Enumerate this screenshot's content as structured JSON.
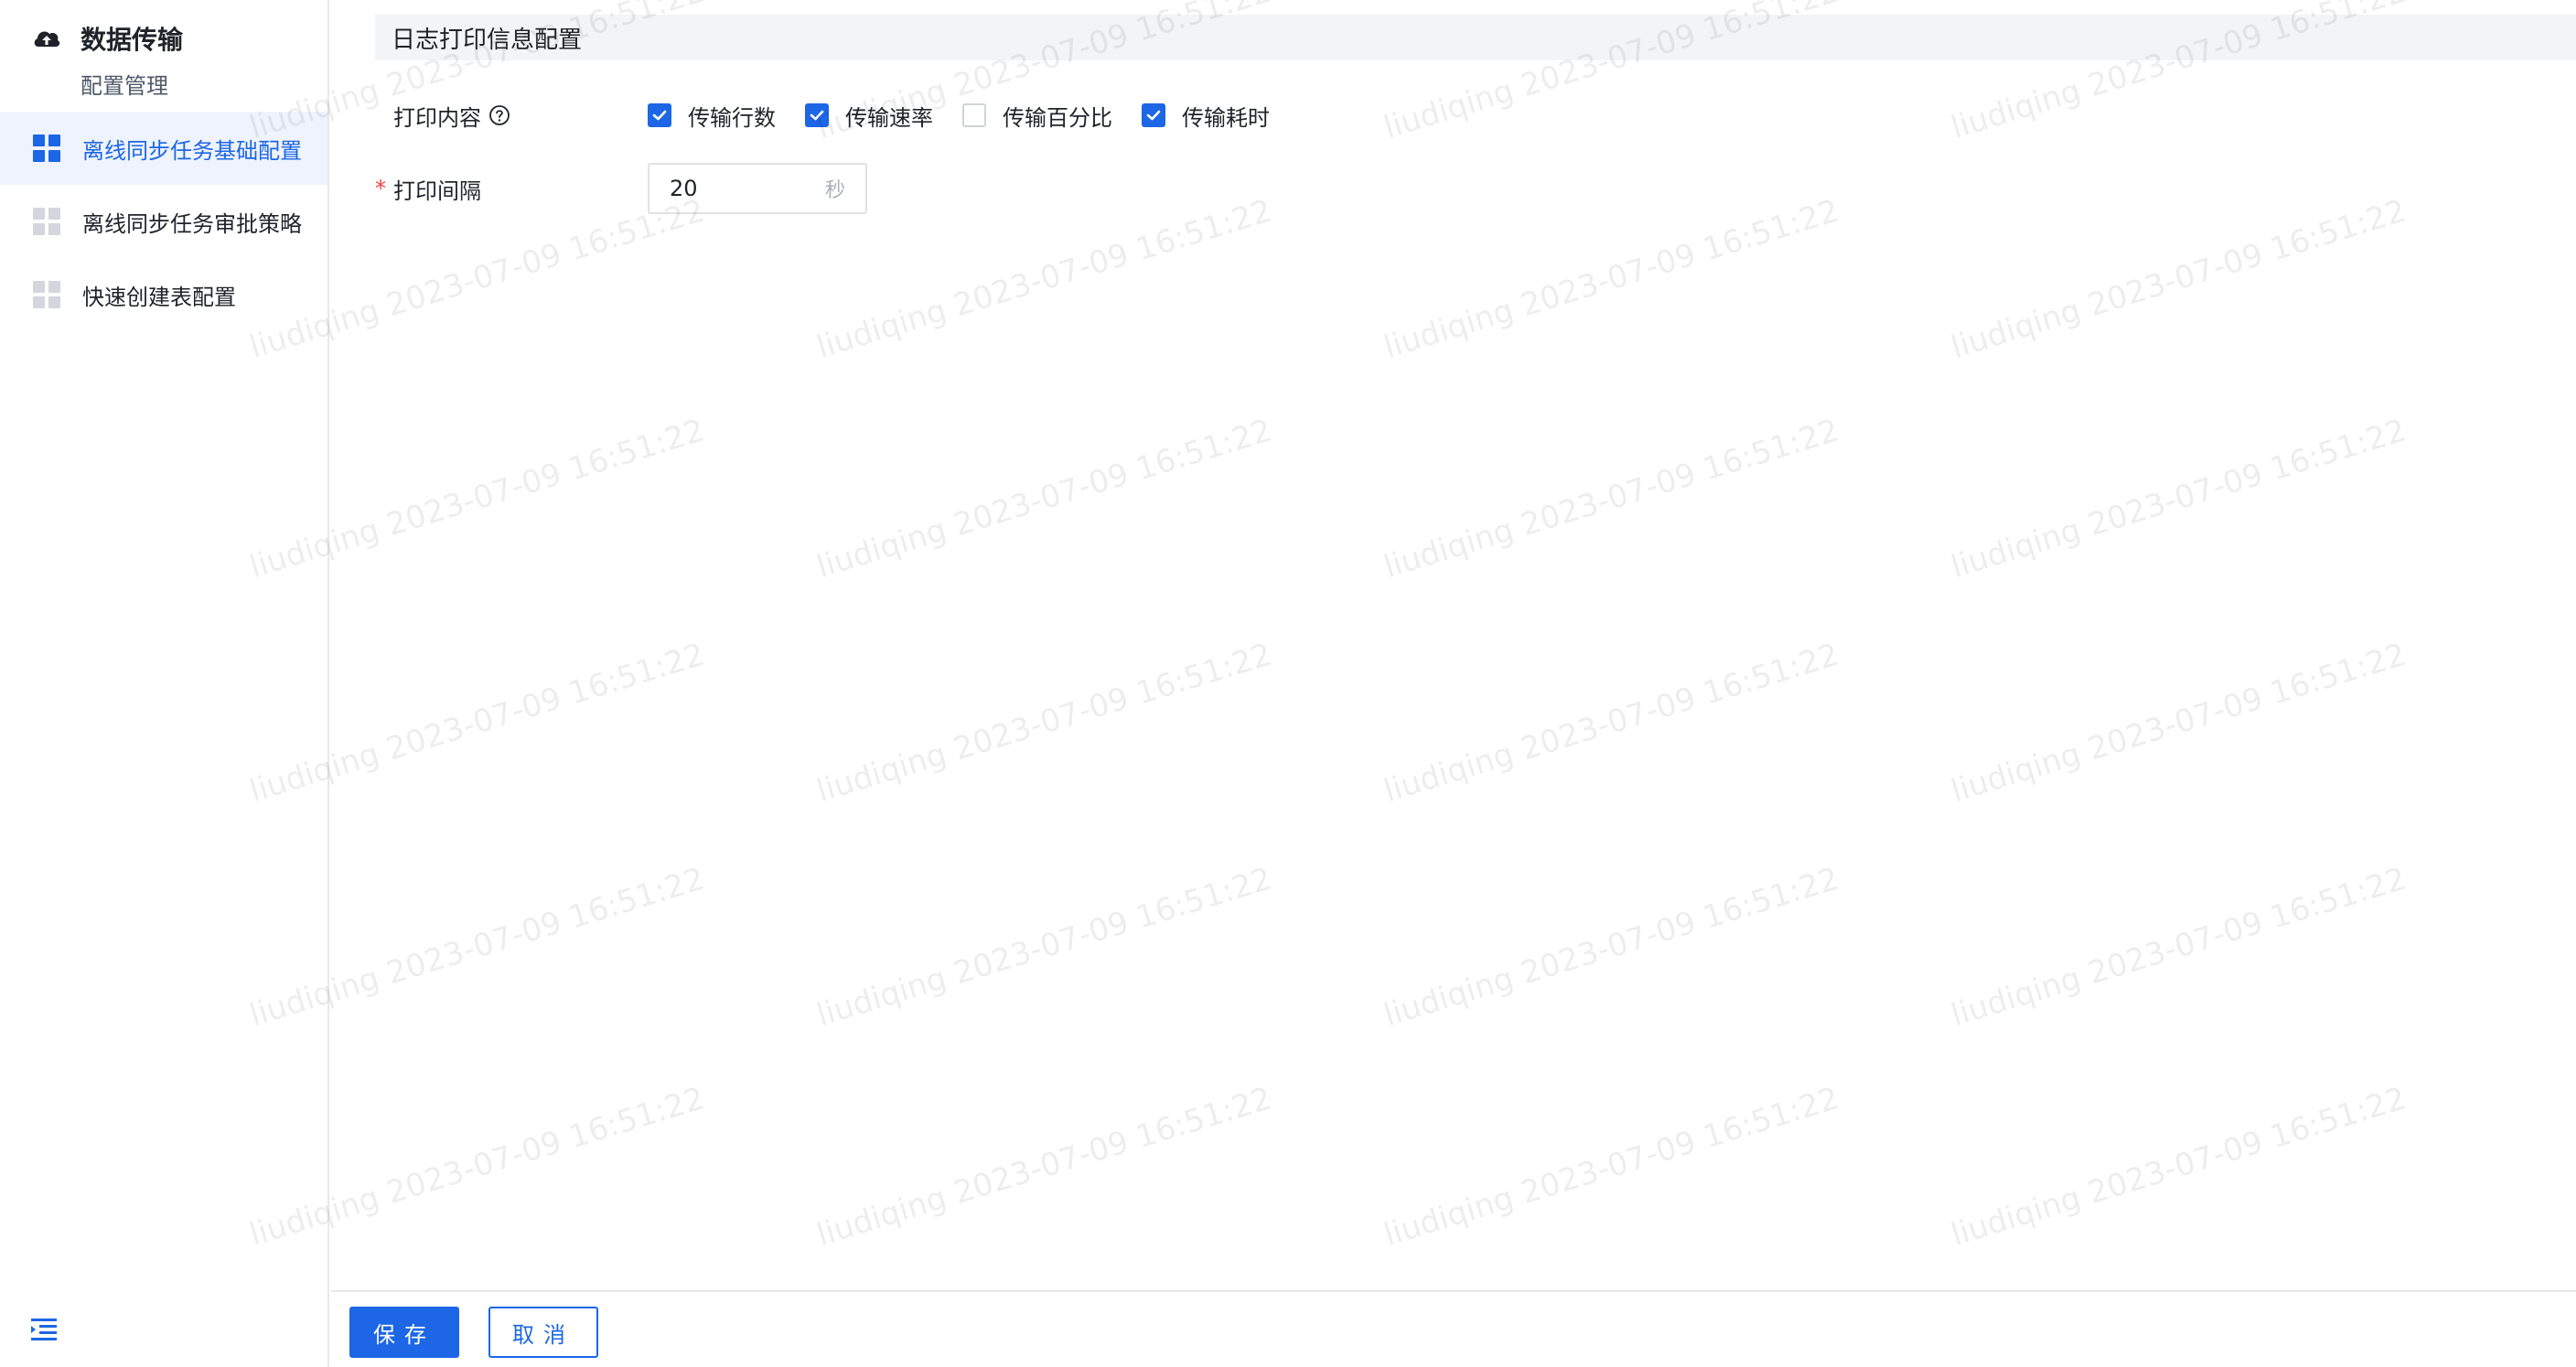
{
  "sidebar": {
    "title": "数据传输",
    "subtitle": "配置管理",
    "items": [
      {
        "label": "离线同步任务基础配置",
        "active": true
      },
      {
        "label": "离线同步任务审批策略",
        "active": false
      },
      {
        "label": "快速创建表配置",
        "active": false
      }
    ]
  },
  "section": {
    "title": "日志打印信息配置"
  },
  "form": {
    "print_content": {
      "label": "打印内容",
      "options": [
        {
          "label": "传输行数",
          "checked": true
        },
        {
          "label": "传输速率",
          "checked": true
        },
        {
          "label": "传输百分比",
          "checked": false
        },
        {
          "label": "传输耗时",
          "checked": true
        }
      ]
    },
    "print_interval": {
      "label": "打印间隔",
      "required_mark": "*",
      "value": "20",
      "unit": "秒"
    }
  },
  "footer": {
    "save_label": "保存",
    "cancel_label": "取消"
  },
  "watermark": {
    "text": "liudiqing 2023-07-09 16:51:22"
  },
  "colors": {
    "accent": "#1d66e5",
    "required": "#f53f3f"
  }
}
